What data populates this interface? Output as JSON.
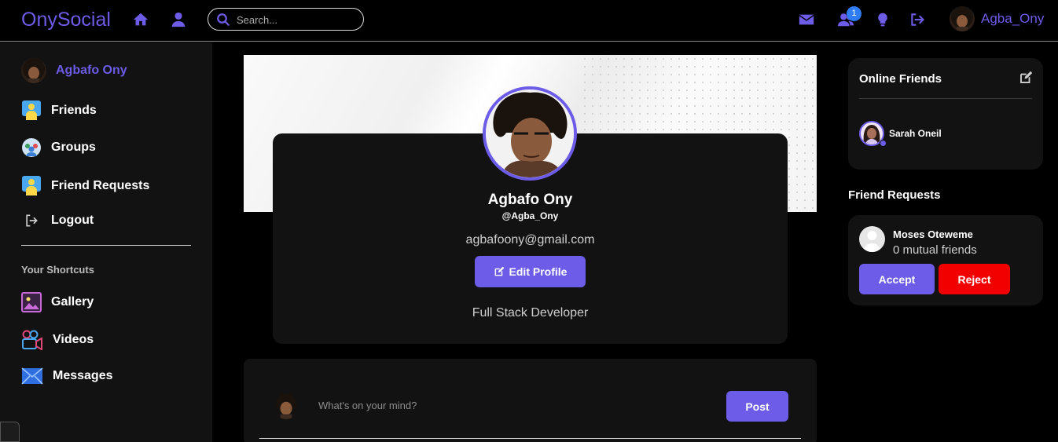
{
  "brand": {
    "name": "OnySocial",
    "accent": "#6c5ce7"
  },
  "topnav": {
    "search_placeholder": "Search...",
    "notification_count": "1",
    "username": "Agba_Ony",
    "icons": [
      "home-icon",
      "user-icon",
      "search-icon",
      "mail-icon",
      "friends-icon",
      "lightbulb-icon",
      "logout-icon"
    ]
  },
  "sidebar": {
    "profile_name": "Agbafo Ony",
    "items": [
      {
        "label": "Friends",
        "icon": "friends-icon"
      },
      {
        "label": "Groups",
        "icon": "groups-icon"
      },
      {
        "label": "Friend Requests",
        "icon": "friend-requests-icon"
      },
      {
        "label": "Logout",
        "icon": "logout-icon"
      }
    ],
    "shortcuts_heading": "Your Shortcuts",
    "shortcuts": [
      {
        "label": "Gallery",
        "icon": "gallery-icon"
      },
      {
        "label": "Videos",
        "icon": "videos-icon"
      },
      {
        "label": "Messages",
        "icon": "messages-icon"
      }
    ]
  },
  "profile": {
    "name": "Agbafo Ony",
    "handle": "@Agba_Ony",
    "email": "agbafoony@gmail.com",
    "edit_label": "Edit Profile",
    "bio": "Full Stack Developer"
  },
  "composer": {
    "placeholder": "What's on your mind?",
    "post_label": "Post"
  },
  "online_friends": {
    "title": "Online Friends",
    "friends": [
      {
        "name": "Sarah Oneil"
      }
    ]
  },
  "friend_requests": {
    "heading": "Friend Requests",
    "requests": [
      {
        "name": "Moses Oteweme",
        "mutual": "0 mutual friends",
        "accept_label": "Accept",
        "reject_label": "Reject"
      }
    ]
  }
}
